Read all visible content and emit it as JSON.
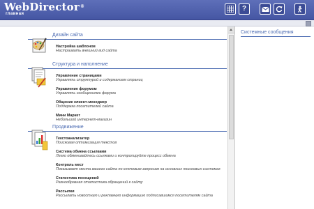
{
  "header": {
    "logo": "WebDirector",
    "logo_reg": "®",
    "subtitle": "главная"
  },
  "toolbar": {
    "buttons": [
      {
        "icon": "grid-icon"
      },
      {
        "icon": "help-icon",
        "label": "?"
      },
      {
        "icon": "mail-icon"
      },
      {
        "icon": "refresh-icon"
      },
      {
        "icon": "exit-icon"
      }
    ]
  },
  "sections": [
    {
      "title": "Дизайн сайта",
      "icon": "brush-palette-icon",
      "items": [
        {
          "title": "Настройка шаблонов",
          "desc": "Настраивать внешний вид сайта"
        }
      ]
    },
    {
      "title": "Структура и наполнение",
      "icon": "documents-pencil-icon",
      "items": [
        {
          "title": "Управление страницами",
          "desc": "Управлять структурой и содержанием страниц"
        },
        {
          "title": "Управление форумом",
          "desc": "Управлять сообщениями форума"
        },
        {
          "title": "Общение клиент-менеджер",
          "desc": "Поддержка посетителей сайта"
        },
        {
          "title": "Мини Маркет",
          "desc": "Небольшой интернет-магазин"
        }
      ]
    },
    {
      "title": "Продвижение",
      "icon": "documents-chart-icon",
      "items": [
        {
          "title": "Текстоанализатор",
          "desc": "Поисковая оптимизация текстов"
        },
        {
          "title": "Система обмена ссылками",
          "desc": "Легко обменивайтесь ссылками и контролируйте процесс обмена"
        },
        {
          "title": "Контроль мест",
          "desc": "Показывает места вашего сайта по ключевым запросам на основных поисковых системах"
        },
        {
          "title": "Статистика посещений",
          "desc": "Разнообразная статистика обращений к сайту"
        },
        {
          "title": "Рассылки",
          "desc": "Рассылать новостную и рекламную информацию подписавшимся посетителям сайта"
        }
      ]
    }
  ],
  "right_panel": {
    "title": "Системные сообщения"
  }
}
